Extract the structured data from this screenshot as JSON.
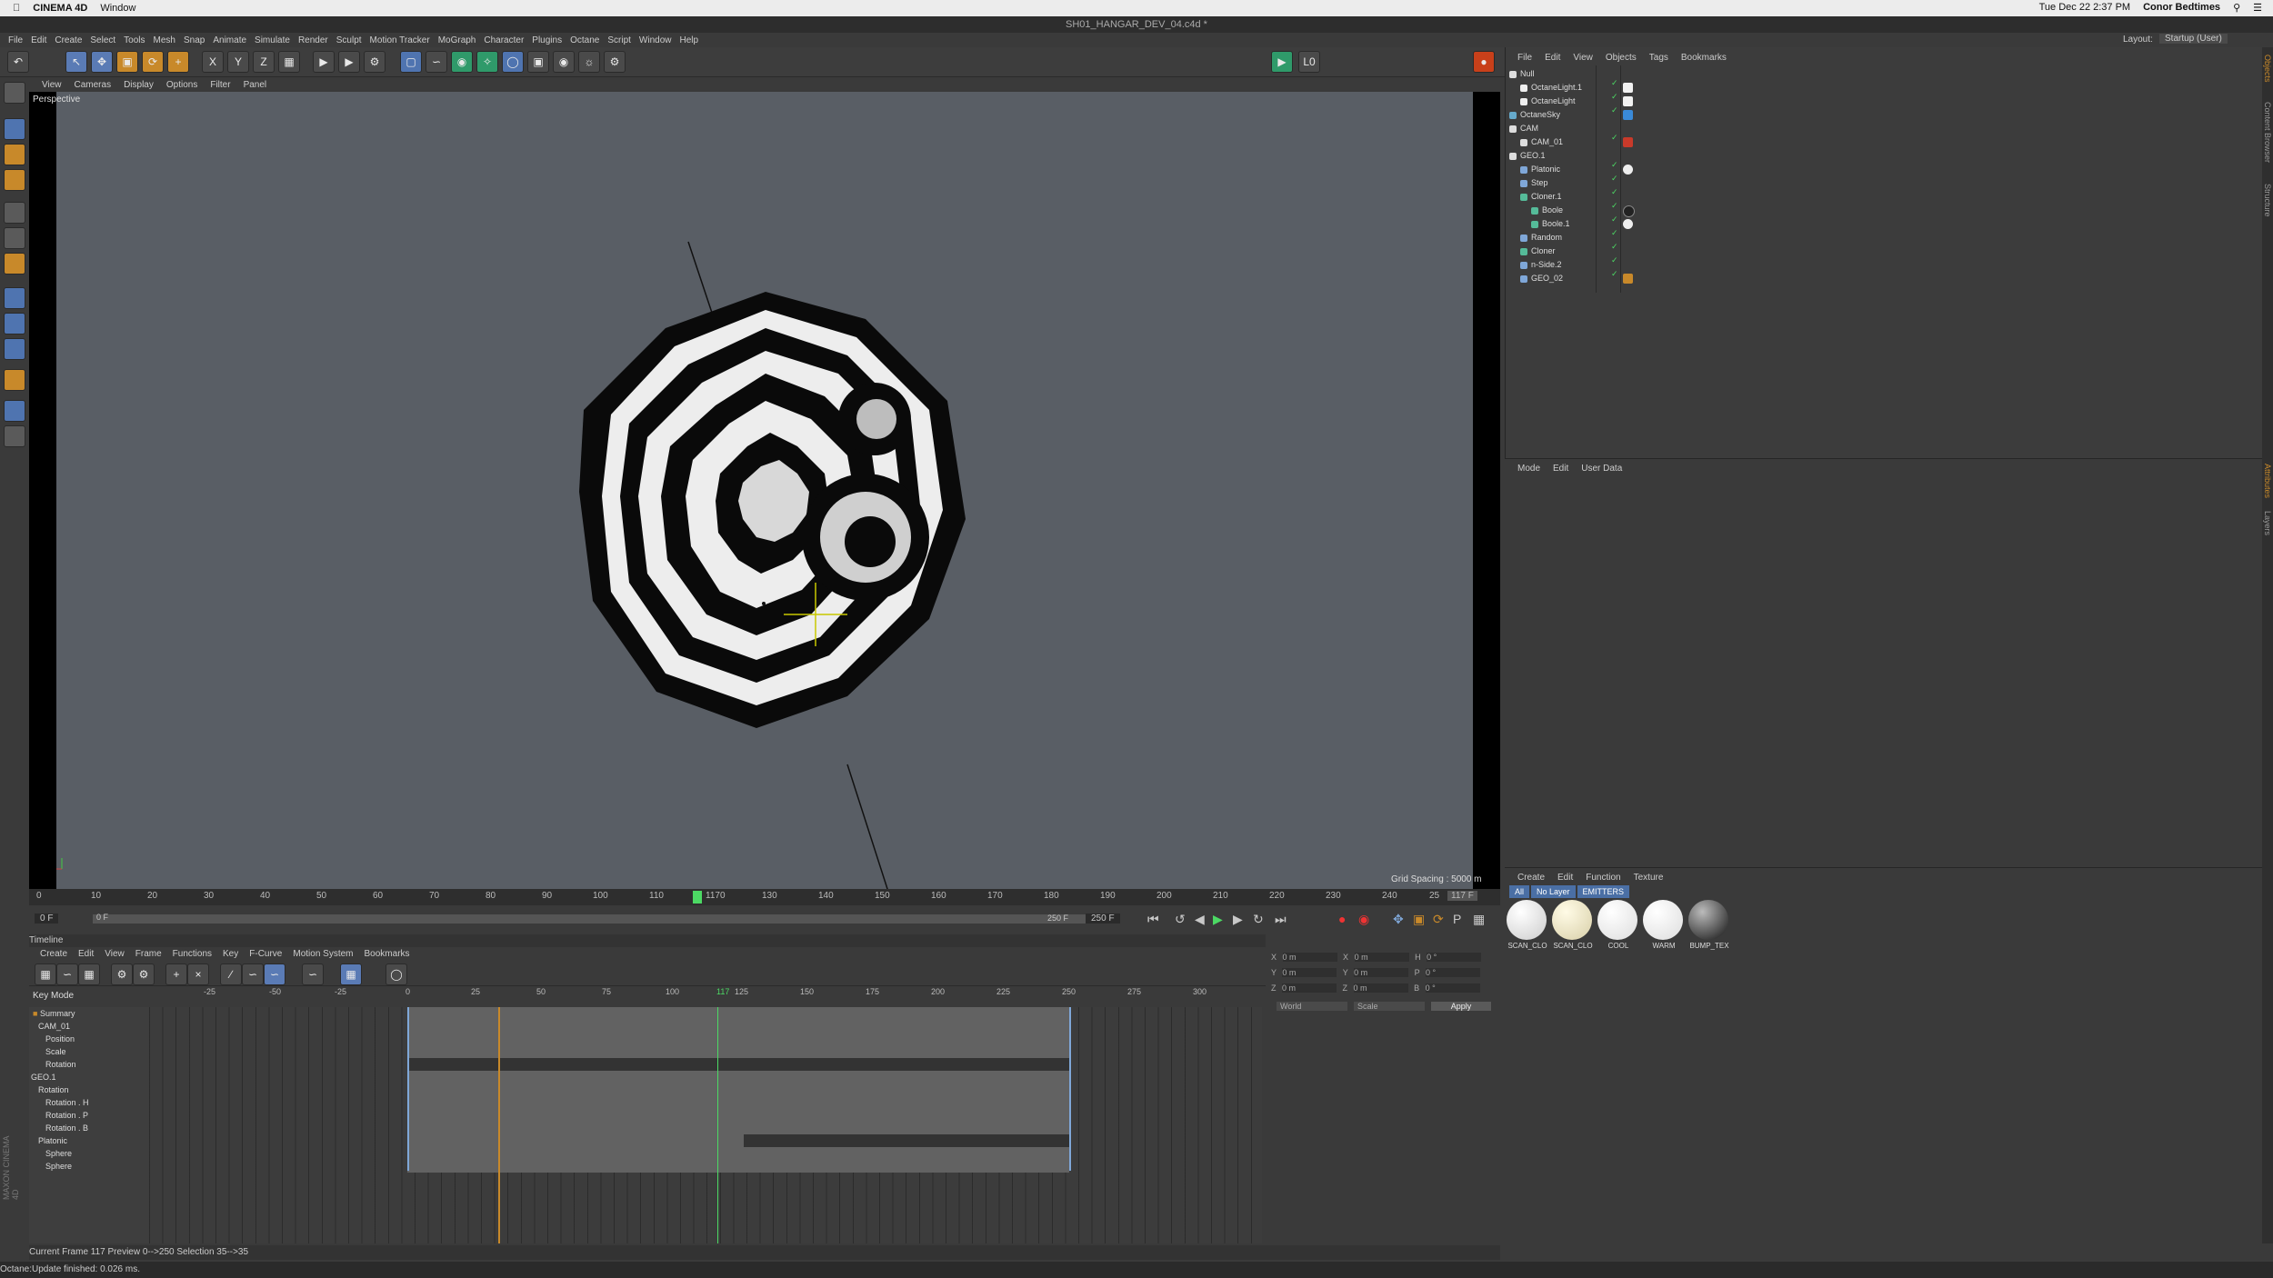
{
  "mac_menubar": {
    "app": "CINEMA 4D",
    "menu": "Window",
    "datetime": "Tue Dec 22  2:37 PM",
    "user": "Conor Bedtimes"
  },
  "window_title": "SH01_HANGAR_DEV_04.c4d *",
  "app_menu": [
    "File",
    "Edit",
    "Create",
    "Select",
    "Tools",
    "Mesh",
    "Snap",
    "Animate",
    "Simulate",
    "Render",
    "Sculpt",
    "Motion Tracker",
    "MoGraph",
    "Character",
    "Plugins",
    "Octane",
    "Script",
    "Window",
    "Help"
  ],
  "layout_label": "Layout:",
  "layout_value": "Startup (User)",
  "viewport": {
    "menu": [
      "View",
      "Cameras",
      "Display",
      "Options",
      "Filter",
      "Panel"
    ],
    "label": "Perspective",
    "grid_spacing": "Grid Spacing : 5000 m"
  },
  "ruler_ticks": [
    "0",
    "10",
    "20",
    "30",
    "40",
    "50",
    "60",
    "70",
    "80",
    "90",
    "100",
    "110",
    "1170",
    "130",
    "140",
    "150",
    "160",
    "170",
    "180",
    "190",
    "200",
    "210",
    "220",
    "230",
    "240",
    "25"
  ],
  "current_frame_field": "117 F",
  "transport": {
    "start": "0 F",
    "start2": "0 F",
    "end": "250 F",
    "end2": "250 F"
  },
  "timeline": {
    "title": "Timeline",
    "menu": [
      "Create",
      "Edit",
      "View",
      "Frame",
      "Functions",
      "Key",
      "F-Curve",
      "Motion System",
      "Bookmarks"
    ],
    "mode": "Key Mode",
    "ruler": [
      "-25",
      "-50",
      "-25",
      "0",
      "25",
      "50",
      "75",
      "100",
      "117",
      "125",
      "150",
      "175",
      "200",
      "225",
      "250",
      "275",
      "300"
    ],
    "tracks": [
      "Summary",
      "CAM_01",
      "Position",
      "Scale",
      "Rotation",
      "GEO.1",
      "Rotation",
      "Rotation . H",
      "Rotation . P",
      "Rotation . B",
      "Platonic",
      "Sphere",
      "Sphere"
    ],
    "status": "Current Frame  117   Preview  0-->250   Selection  35-->35"
  },
  "coords": {
    "rows": [
      [
        "X",
        "0 m",
        "X",
        "0 m",
        "H",
        "0 °"
      ],
      [
        "Y",
        "0 m",
        "Y",
        "0 m",
        "P",
        "0 °"
      ],
      [
        "Z",
        "0 m",
        "Z",
        "0 m",
        "B",
        "0 °"
      ]
    ],
    "world": "World",
    "scale": "Scale",
    "apply": "Apply"
  },
  "status_bar": "Octane:Update finished: 0.026 ms.",
  "objects": {
    "menu": [
      "File",
      "Edit",
      "View",
      "Objects",
      "Tags",
      "Bookmarks"
    ],
    "items": [
      "Null",
      "OctaneLight.1",
      "OctaneLight",
      "OctaneSky",
      "CAM",
      "CAM_01",
      "GEO.1",
      "Platonic",
      "Step",
      "Cloner.1",
      "Boole",
      "Boole.1",
      "Random",
      "Cloner",
      "n-Side.2",
      "GEO_02"
    ]
  },
  "attributes": {
    "menu": [
      "Mode",
      "Edit",
      "User Data"
    ]
  },
  "materials": {
    "menu": [
      "Create",
      "Edit",
      "Function",
      "Texture"
    ],
    "tabs": [
      "All",
      "No Layer",
      "EMITTERS"
    ],
    "items": [
      "SCAN_CLO",
      "SCAN_CLO",
      "COOL",
      "WARM",
      "BUMP_TEX"
    ]
  },
  "side_tabs": [
    "Objects",
    "Content Browser",
    "Structure",
    "Attributes",
    "Layers"
  ],
  "brand": "MAXON CINEMA 4D"
}
